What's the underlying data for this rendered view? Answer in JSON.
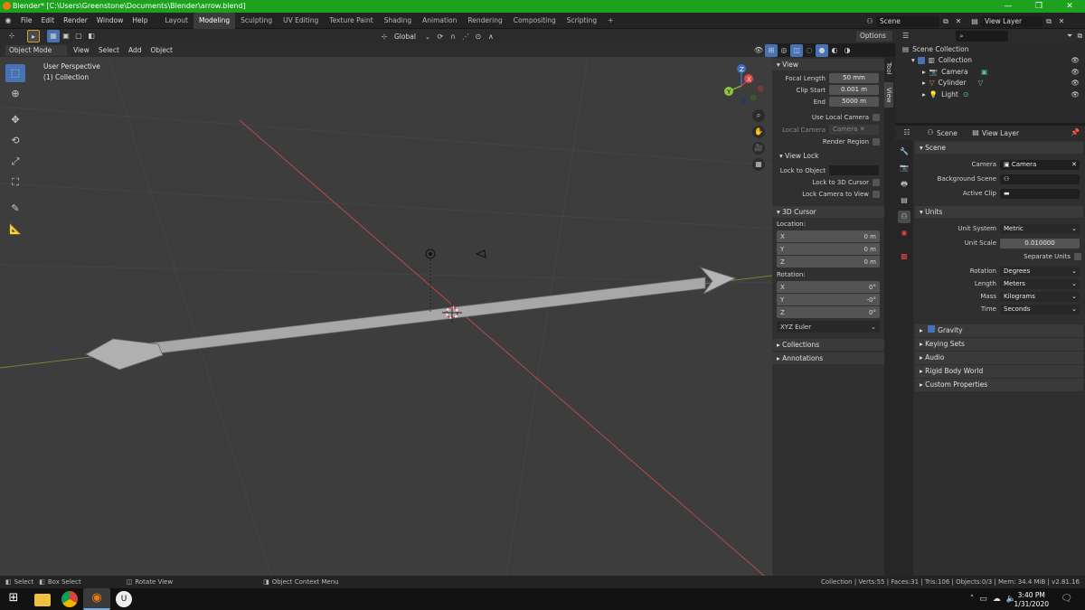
{
  "window": {
    "title": "Blender* [C:\\Users\\Greenstone\\Documents\\Blender\\arrow.blend]",
    "min": "—",
    "max": "❐",
    "close": "✕"
  },
  "menu": [
    "File",
    "Edit",
    "Render",
    "Window",
    "Help"
  ],
  "workspaces": [
    "Layout",
    "Modeling",
    "Sculpting",
    "UV Editing",
    "Texture Paint",
    "Shading",
    "Animation",
    "Rendering",
    "Compositing",
    "Scripting"
  ],
  "workspace_add": "+",
  "scene_field": "Scene",
  "view_layer_field": "View Layer",
  "toolbar": {
    "transform_orientation": "Global",
    "options": "Options"
  },
  "header": {
    "mode": "Object Mode",
    "menus": [
      "View",
      "Select",
      "Add",
      "Object"
    ]
  },
  "viewport": {
    "perspective": "User Perspective",
    "collection": "(1) Collection",
    "gizmo": {
      "x": "X",
      "y": "Y",
      "z": "Z"
    }
  },
  "npanel": {
    "tabs": [
      "Tool",
      "View"
    ],
    "view": {
      "header": "View",
      "focal_length_label": "Focal Length",
      "focal_length": "50 mm",
      "clip_start_label": "Clip Start",
      "clip_start": "0.001 m",
      "end_label": "End",
      "end": "5000 m",
      "use_local_camera": "Use Local Camera",
      "local_camera_label": "Local Camera",
      "local_camera": "Camera",
      "render_region": "Render Region"
    },
    "view_lock": {
      "header": "View Lock",
      "lock_to_object": "Lock to Object",
      "lock_to_3d_cursor": "Lock to 3D Cursor",
      "lock_camera_to_view": "Lock Camera to View"
    },
    "cursor": {
      "header": "3D Cursor",
      "location": "Location:",
      "x": "X",
      "x_val": "0 m",
      "y": "Y",
      "y_val": "0 m",
      "z": "Z",
      "z_val": "0 m",
      "rotation": "Rotation:",
      "rx": "X",
      "rx_val": "0°",
      "ry": "Y",
      "ry_val": "-0°",
      "rz": "Z",
      "rz_val": "0°",
      "mode": "XYZ Euler"
    },
    "collections": "Collections",
    "annotations": "Annotations"
  },
  "outliner": {
    "scene_collection": "Scene Collection",
    "collection": "Collection",
    "items": [
      "Camera",
      "Cylinder",
      "Light"
    ]
  },
  "properties": {
    "scene_field": "Scene",
    "view_layer_field": "View Layer",
    "scene_header": "Scene",
    "camera_label": "Camera",
    "camera": "Camera",
    "bg_scene_label": "Background Scene",
    "active_clip_label": "Active Clip",
    "units_header": "Units",
    "unit_system_label": "Unit System",
    "unit_system": "Metric",
    "unit_scale_label": "Unit Scale",
    "unit_scale": "0.010000",
    "separate_units": "Separate Units",
    "rotation_label": "Rotation",
    "rotation": "Degrees",
    "length_label": "Length",
    "length": "Meters",
    "mass_label": "Mass",
    "mass": "Kilograms",
    "time_label": "Time",
    "time": "Seconds",
    "panels": [
      "Gravity",
      "Keying Sets",
      "Audio",
      "Rigid Body World",
      "Custom Properties"
    ]
  },
  "status": {
    "select": "Select",
    "box_select": "Box Select",
    "rotate_view": "Rotate View",
    "context_menu": "Object Context Menu",
    "stats": "Collection | Verts:55 | Faces:31 | Tris:106 | Objects:0/3 | Mem: 34.4 MiB | v2.81.16"
  },
  "taskbar": {
    "time": "3:40 PM",
    "date": "1/31/2020"
  },
  "colors": {
    "title_green": "#1ea11f",
    "accent_blue": "#4772b3",
    "axis_red": "#c03a3a",
    "axis_green": "#7aa23a"
  }
}
